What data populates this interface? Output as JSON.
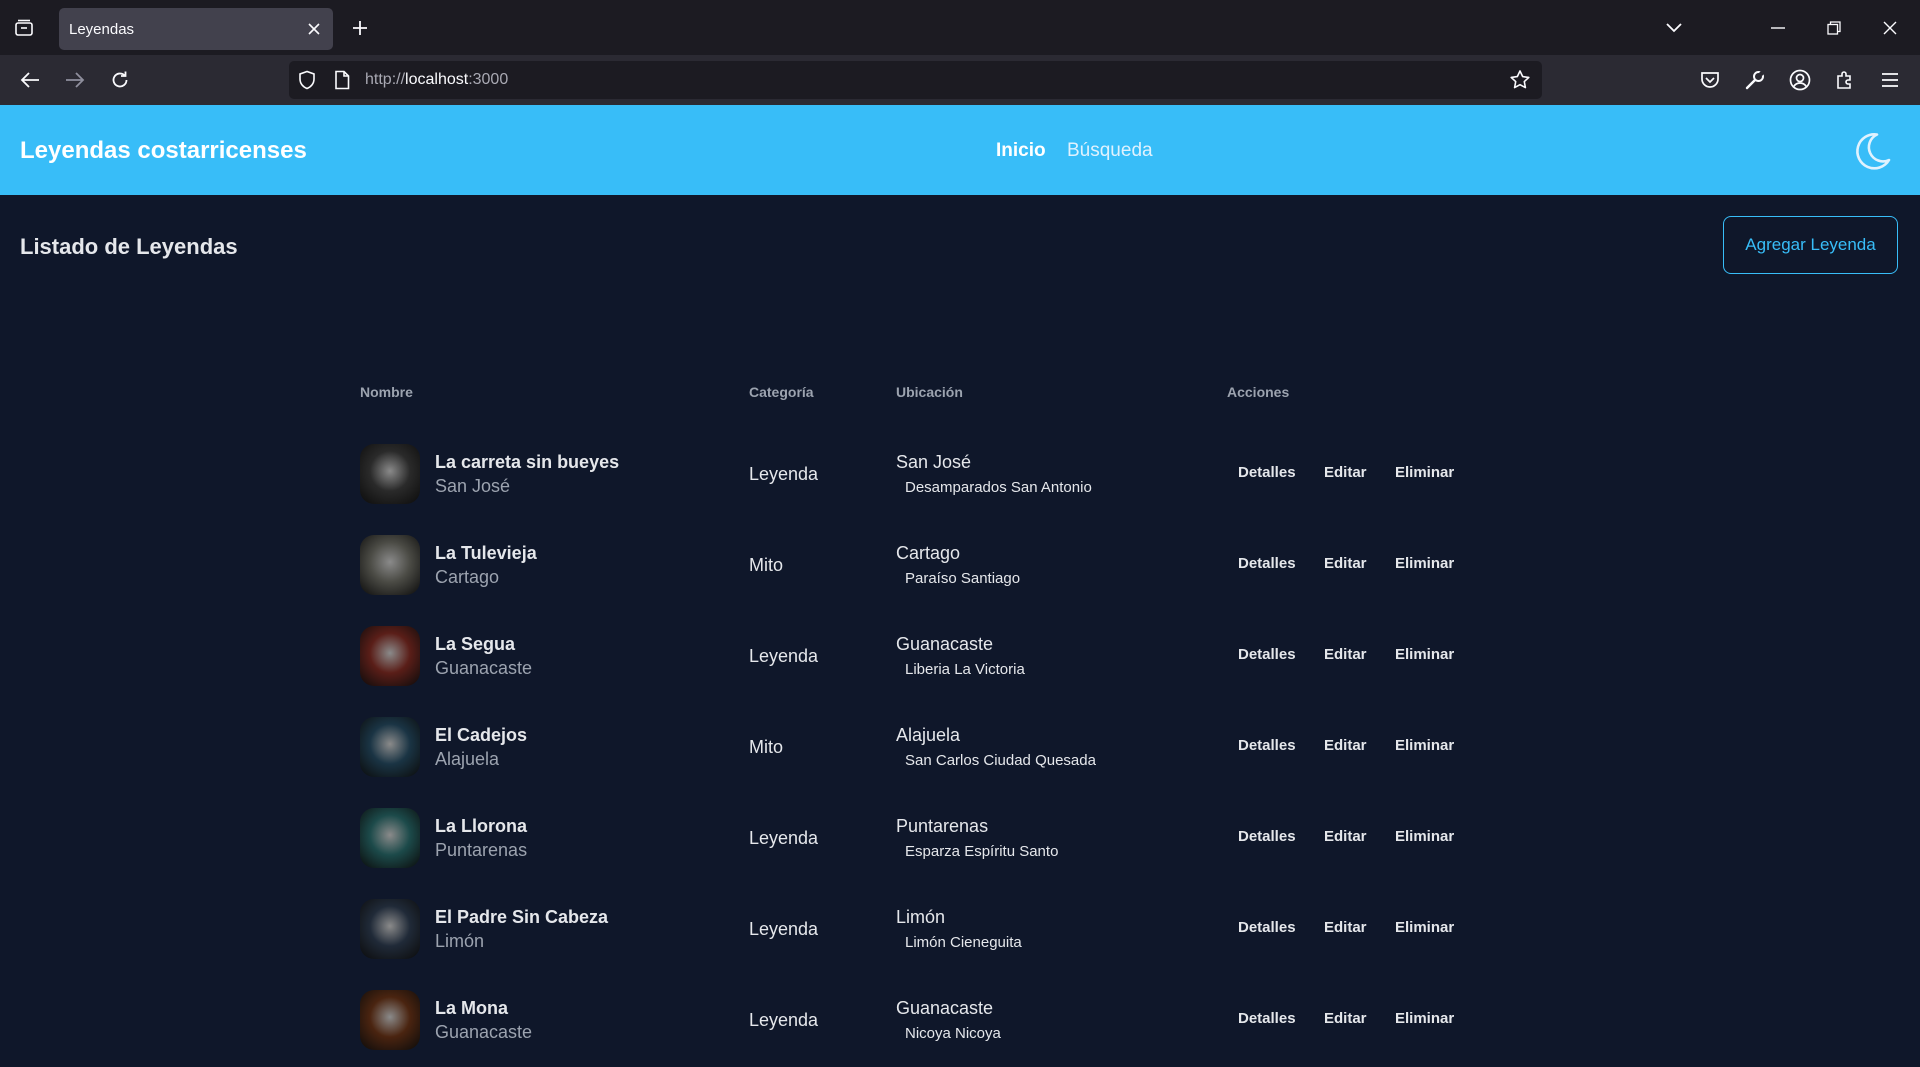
{
  "browser": {
    "tab_title": "Leyendas",
    "url_scheme": "http://",
    "url_host": "localhost",
    "url_port": ":3000"
  },
  "header": {
    "brand": "Leyendas costarricenses",
    "nav": [
      {
        "label": "Inicio",
        "active": true
      },
      {
        "label": "Búsqueda",
        "active": false
      }
    ],
    "theme_icon": "moon-icon"
  },
  "page": {
    "title": "Listado de Leyendas",
    "add_button": "Agregar Leyenda"
  },
  "table": {
    "headers": {
      "name": "Nombre",
      "category": "Categoría",
      "location": "Ubicación",
      "actions": "Acciones"
    },
    "action_labels": {
      "details": "Detalles",
      "edit": "Editar",
      "delete": "Eliminar"
    },
    "rows": [
      {
        "name": "La carreta sin bueyes",
        "province": "San José",
        "category": "Leyenda",
        "location_province": "San José",
        "location_detail": "Desamparados San Antonio",
        "thumb_color": "#2a2a2a"
      },
      {
        "name": "La Tulevieja",
        "province": "Cartago",
        "category": "Mito",
        "location_province": "Cartago",
        "location_detail": "Paraíso Santiago",
        "thumb_color": "#4b4b45"
      },
      {
        "name": "La Segua",
        "province": "Guanacaste",
        "category": "Leyenda",
        "location_province": "Guanacaste",
        "location_detail": "Liberia La Victoria",
        "thumb_color": "#5a1e18"
      },
      {
        "name": "El Cadejos",
        "province": "Alajuela",
        "category": "Mito",
        "location_province": "Alajuela",
        "location_detail": "San Carlos Ciudad Quesada",
        "thumb_color": "#1a3444"
      },
      {
        "name": "La Llorona",
        "province": "Puntarenas",
        "category": "Leyenda",
        "location_province": "Puntarenas",
        "location_detail": "Esparza Espíritu Santo",
        "thumb_color": "#1c4a4a"
      },
      {
        "name": "El Padre Sin Cabeza",
        "province": "Limón",
        "category": "Leyenda",
        "location_province": "Limón",
        "location_detail": "Limón Cieneguita",
        "thumb_color": "#202a38"
      },
      {
        "name": "La Mona",
        "province": "Guanacaste",
        "category": "Leyenda",
        "location_province": "Guanacaste",
        "location_detail": "Nicoya Nicoya",
        "thumb_color": "#4a2410"
      }
    ]
  },
  "colors": {
    "accent": "#38bdf8",
    "background": "#0f172a"
  }
}
